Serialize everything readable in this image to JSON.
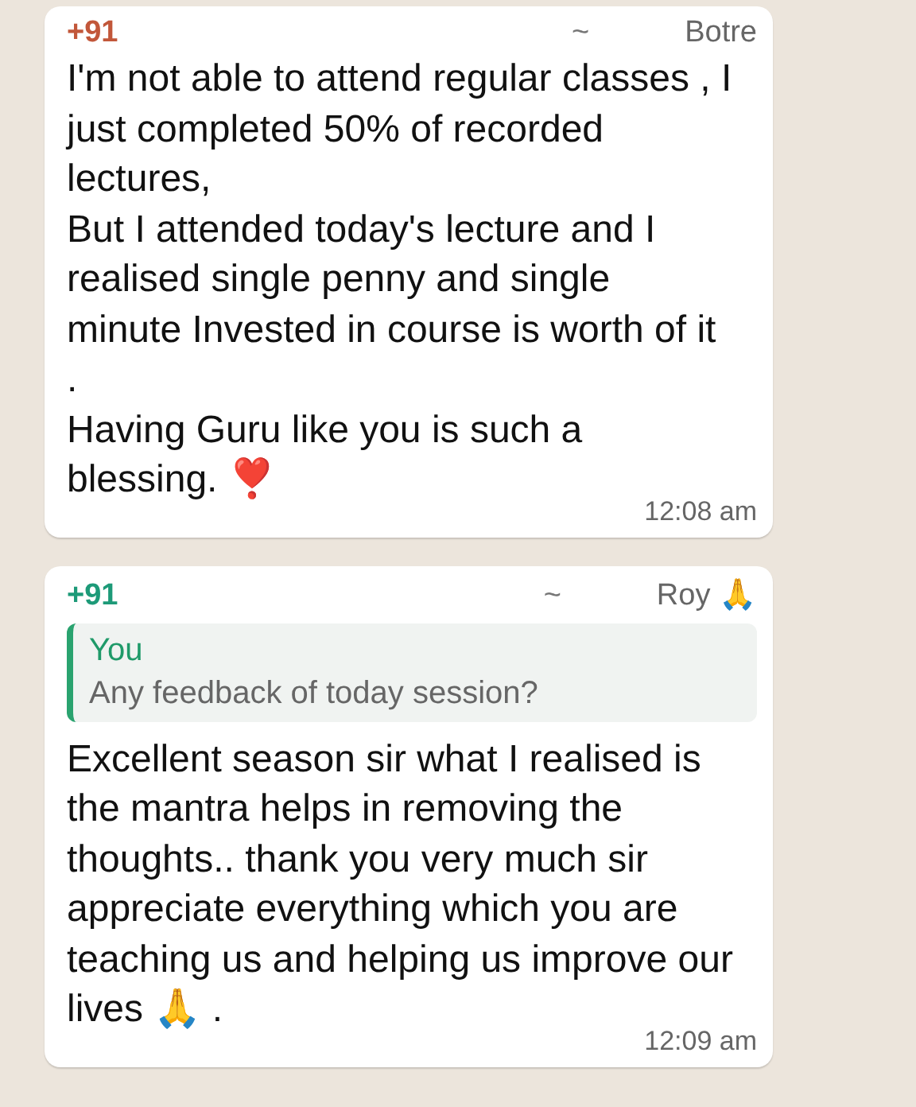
{
  "messages": [
    {
      "phone": "+91",
      "color": "#c2573a",
      "tilde": "~",
      "name": "Botre",
      "lines": [
        "I'm not able to attend regular classes , I just completed 50% of recorded lectures,",
        "But I attended today's lecture and I realised single penny and single minute Invested in course is worth of it .",
        "Having Guru like you is such a blessing. ❣️"
      ],
      "time": "12:08 am"
    },
    {
      "phone": "+91",
      "color": "#1d9a78",
      "tilde": "~",
      "name": "Roy 🙏",
      "quote": {
        "author": "You",
        "text": "Any feedback of today session?"
      },
      "lines": [
        "Excellent season sir what I realised is the mantra helps in  removing the thoughts.. thank you very much sir appreciate everything which you are teaching us and helping us improve our lives 🙏 ."
      ],
      "time": "12:09 am"
    }
  ]
}
